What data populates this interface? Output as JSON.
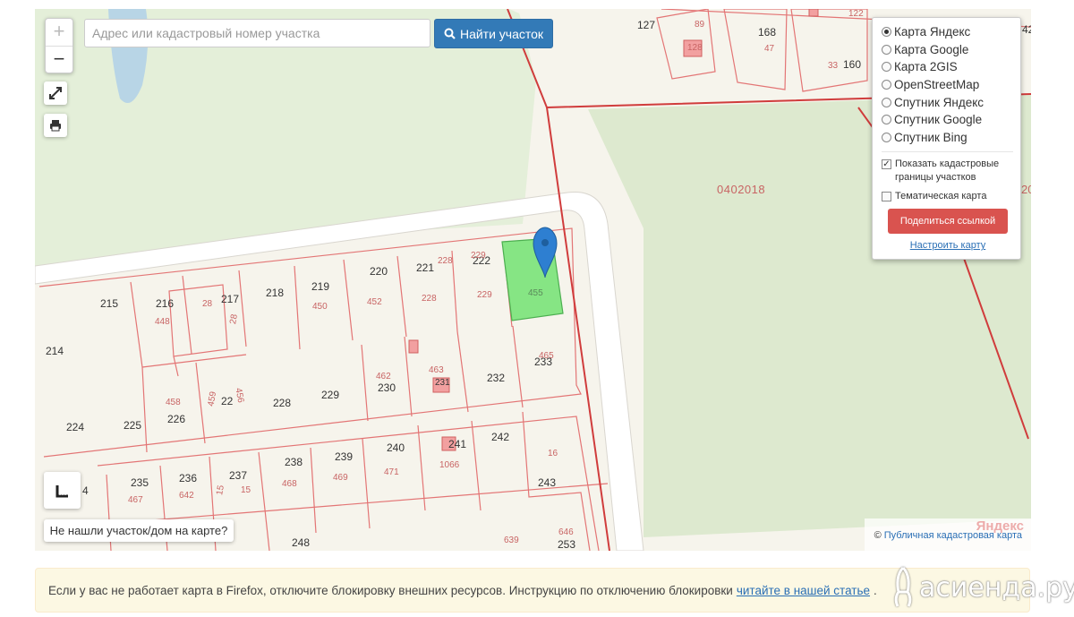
{
  "search": {
    "placeholder": "Адрес или кадастровый номер участка",
    "button_label": "Найти участок"
  },
  "zoom": {
    "in_label": "+",
    "out_label": "−"
  },
  "layers": {
    "options": [
      "Карта Яндекс",
      "Карта Google",
      "Карта 2GIS",
      "OpenStreetMap",
      "Спутник Яндекс",
      "Спутник Google",
      "Спутник Bing"
    ],
    "selected": "Карта Яндекс",
    "show_boundaries_label": "Показать кадастровые границы участков",
    "show_boundaries_checked": true,
    "thematic_label": "Тематическая карта",
    "thematic_checked": false,
    "share_label": "Поделиться ссылкой",
    "settings_label": "Настроить карту"
  },
  "map": {
    "quarter_label": "0402018",
    "quarter_label_right": "20",
    "house_numbers": [
      "127",
      "168",
      "160",
      "215",
      "216",
      "217",
      "218",
      "219",
      "220",
      "221",
      "222",
      "214",
      "224",
      "225",
      "226",
      "22",
      "228",
      "229",
      "230",
      "232",
      "233",
      "235",
      "236",
      "237",
      "238",
      "239",
      "240",
      "241",
      "242",
      "243",
      "248",
      "253",
      "4",
      "42"
    ],
    "parcel_numbers": [
      "89",
      "128",
      "47",
      "33",
      "122",
      "448",
      "28",
      "28",
      "450",
      "452",
      "228",
      "228",
      "229",
      "229",
      "455",
      "462",
      "463",
      "231",
      "465",
      "458",
      "459",
      "456",
      "467",
      "642",
      "15",
      "15",
      "468",
      "469",
      "471",
      "1066",
      "16",
      "639",
      "646"
    ],
    "not_found_label": "Не нашли участок/дом на карте?",
    "attribution_link": "Публичная кадастровая карта",
    "attribution_prefix": "©",
    "yandex_logo": "Яндекс"
  },
  "notice": {
    "text": "Если у вас не работает карта в Firefox, отключите блокировку внешних ресурсов. Инструкцию по отключению блокировки",
    "link_text": "читайте в нашей статье",
    "suffix": "."
  },
  "watermark": {
    "text": "асиенда.ру"
  },
  "colors": {
    "boundary": "#e05a5a",
    "selected_parcel": "#7ee07e",
    "building": "#f19a9a",
    "primary": "#337ab7",
    "danger": "#d9534f"
  }
}
